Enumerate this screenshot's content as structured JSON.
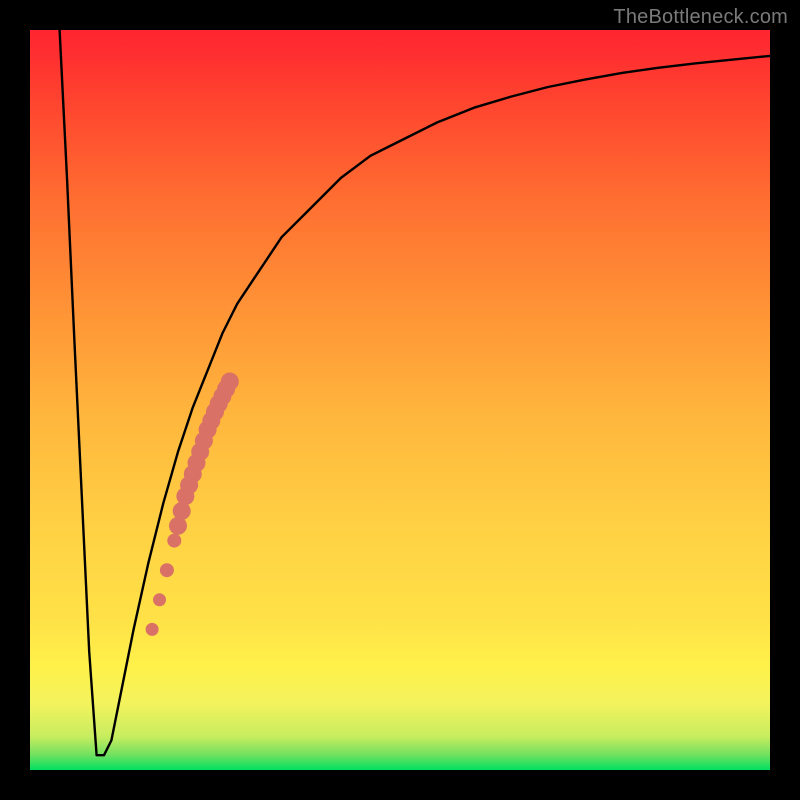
{
  "watermark": "TheBottleneck.com",
  "chart_data": {
    "type": "line",
    "title": "",
    "xlabel": "",
    "ylabel": "",
    "xlim": [
      0,
      100
    ],
    "ylim": [
      0,
      100
    ],
    "background_gradient": {
      "top_color": "#ff2430",
      "mid_colors": [
        "#ff9436",
        "#ffd244",
        "#fff14a"
      ],
      "bottom_color": "#00e060"
    },
    "series": [
      {
        "name": "bottleneck-curve",
        "x": [
          4,
          5,
          6,
          7,
          8,
          9,
          10,
          11,
          12,
          13,
          14,
          16,
          18,
          20,
          22,
          24,
          26,
          28,
          30,
          34,
          38,
          42,
          46,
          50,
          55,
          60,
          65,
          70,
          75,
          80,
          85,
          90,
          95,
          100
        ],
        "y": [
          100,
          80,
          58,
          37,
          16,
          2,
          2,
          4,
          9,
          14,
          19,
          28,
          36,
          43,
          49,
          54,
          59,
          63,
          66,
          72,
          76,
          80,
          83,
          85,
          87.5,
          89.5,
          91,
          92.3,
          93.3,
          94.2,
          94.9,
          95.5,
          96,
          96.5
        ]
      }
    ],
    "annotations": {
      "dots": {
        "name": "highlighted-segment",
        "color": "#d97166",
        "points": [
          {
            "x": 16.5,
            "y": 19
          },
          {
            "x": 17.5,
            "y": 23
          },
          {
            "x": 18.5,
            "y": 27
          },
          {
            "x": 19.5,
            "y": 31
          },
          {
            "x": 20.0,
            "y": 33
          },
          {
            "x": 20.5,
            "y": 35
          },
          {
            "x": 21.0,
            "y": 37
          },
          {
            "x": 21.5,
            "y": 38.5
          },
          {
            "x": 22.0,
            "y": 40
          },
          {
            "x": 22.5,
            "y": 41.5
          },
          {
            "x": 23.0,
            "y": 43
          },
          {
            "x": 23.5,
            "y": 44.5
          },
          {
            "x": 24.0,
            "y": 46
          },
          {
            "x": 24.5,
            "y": 47.2
          },
          {
            "x": 25.0,
            "y": 48.4
          },
          {
            "x": 25.5,
            "y": 49.5
          },
          {
            "x": 26.0,
            "y": 50.5
          },
          {
            "x": 26.5,
            "y": 51.5
          },
          {
            "x": 27.0,
            "y": 52.5
          }
        ]
      }
    }
  }
}
